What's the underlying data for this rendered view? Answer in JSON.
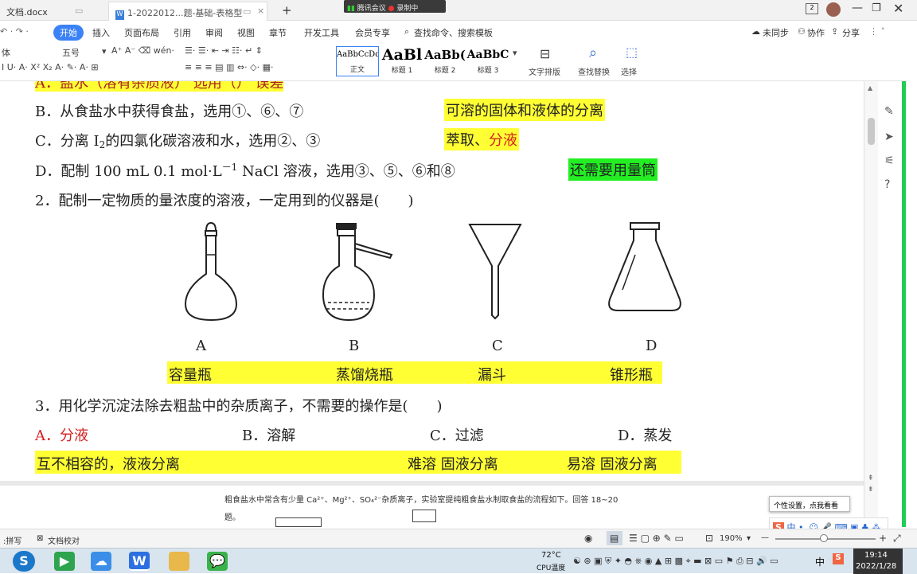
{
  "tabs": {
    "doc1": "文档.docx",
    "doc2": "1-2022012...题-基础-表格型",
    "add": "+"
  },
  "meeting": {
    "status": "腾讯会议",
    "recording": "录制中"
  },
  "menu": {
    "home": "开始",
    "insert": "插入",
    "layout": "页面布局",
    "references": "引用",
    "review": "审阅",
    "view": "视图",
    "chapter": "章节",
    "developer": "开发工具",
    "special": "会员专享",
    "search": "查找命令、搜索模板",
    "unsync": "未同步",
    "collab": "协作",
    "share": "分享"
  },
  "toolbar": {
    "font_size": "五号",
    "styles": [
      {
        "preview": "AaBbCcDd",
        "label": "正文"
      },
      {
        "preview": "AaBl",
        "label": "标题 1"
      },
      {
        "preview": "AaBb(",
        "label": "标题 2"
      },
      {
        "preview": "AaBbC",
        "label": "标题 3"
      }
    ],
    "text_layout": "文字排版",
    "find_replace": "查找替换",
    "select": "选择"
  },
  "doc": {
    "cut_line": "A．盐水（溶有杂质液） 选用（）  误差",
    "lineB": {
      "text": "B．从食盐水中获得食盐，选用①、⑥、⑦",
      "note": "可溶的固体和液体的分离"
    },
    "lineC": {
      "pre": "C．分离 I",
      "sub": "2",
      "post": "的四氯化碳溶液和水，选用②、③",
      "note1": "萃取、",
      "note2": "分液"
    },
    "lineD": {
      "pre": "D．配制 100 mL 0.1 mol·L",
      "sup": "－1",
      "post": " NaCl 溶液，选用③、⑤、⑥和⑧",
      "note": "还需要用量筒"
    },
    "q2": "2．配制一定物质的量浓度的溶液，一定用到的仪器是(　　)",
    "letters": {
      "a": "A",
      "b": "B",
      "c": "C",
      "d": "D"
    },
    "names": {
      "a": "容量瓶",
      "b": "蒸馏烧瓶",
      "c": "漏斗",
      "d": "锥形瓶"
    },
    "q3": "3．用化学沉淀法除去粗盐中的杂质离子，不需要的操作是(　　)",
    "opts": {
      "a": "A．分液",
      "b": "B．溶解",
      "c": "C．过滤",
      "d": "D．蒸发"
    },
    "notes3": {
      "a": "互不相容的，液液分离",
      "b": "难溶  固液分离",
      "c": "易溶  固液分离"
    },
    "small_text": "粗食盐水中常含有少量 Ca²⁺、Mg²⁺、SO₄²⁻杂质离子，实验室提纯粗食盐水制取食盐的流程如下。回答 18~20",
    "small_text2": "题。",
    "tooltip": "个性设置，点我看看"
  },
  "status": {
    "doc_check": "文档校对",
    "zoom": "190%"
  },
  "taskbar": {
    "temp": "72°C",
    "cpu": "CPU温度",
    "time": "19:14",
    "date": "2022/1/28",
    "ime": "中"
  }
}
